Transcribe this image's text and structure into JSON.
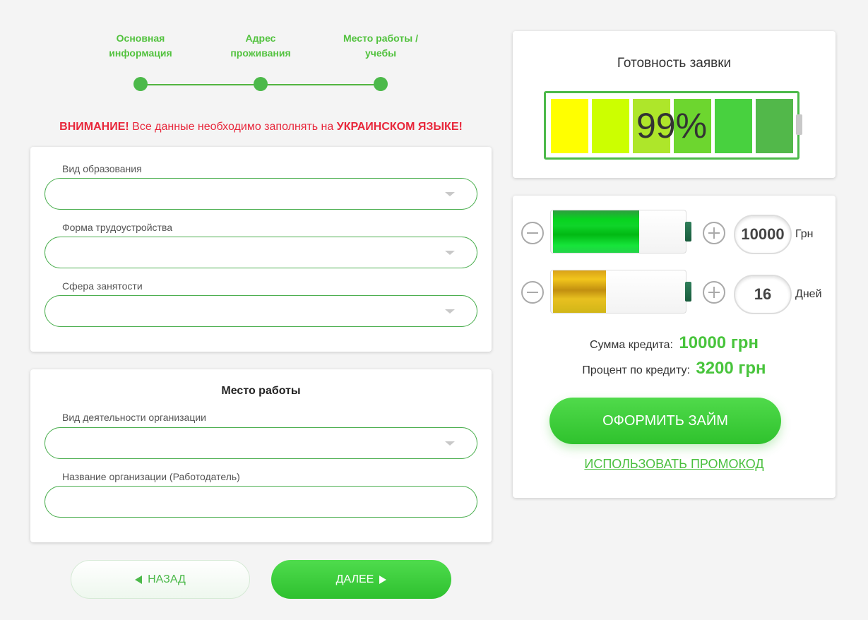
{
  "stepper": {
    "steps": [
      {
        "label": "Основная информация"
      },
      {
        "label": "Адрес проживания"
      },
      {
        "label": "Место работы / учебы"
      }
    ]
  },
  "warning": {
    "prefix": "ВНИМАНИЕ!",
    "text": " Все данные необходимо заполнять на ",
    "emphasis": "УКРАИНСКОМ ЯЗЫКЕ!"
  },
  "employment_card": {
    "fields": [
      {
        "label": "Вид образования",
        "value": ""
      },
      {
        "label": "Форма трудоустройства",
        "value": ""
      },
      {
        "label": "Сфера занятости",
        "value": ""
      }
    ]
  },
  "workplace_card": {
    "title": "Место работы",
    "activity_label": "Вид деятельности организации",
    "activity_value": "",
    "employer_label": "Название организации (Работодатель)",
    "employer_value": ""
  },
  "nav": {
    "back_label": "Назад",
    "next_label": "Далее"
  },
  "readiness": {
    "title": "Готовность заявки",
    "percent_label": "99%",
    "percent": 99,
    "cell_colors": [
      "#ffff00",
      "#ccff00",
      "#aee62a",
      "#6dd62f",
      "#48d13f",
      "#52b84a"
    ]
  },
  "calculator": {
    "amount": {
      "value": "10000",
      "unit": "Грн",
      "fill_fraction": 0.65
    },
    "days": {
      "value": "16",
      "unit": "Дней",
      "fill_fraction": 0.4
    },
    "sum_label": "Сумма кредита:",
    "sum_value": "10000 грн",
    "interest_label": "Процент по кредиту:",
    "interest_value": "3200 грн",
    "apply_label": "Оформить займ",
    "promo_label": "Использовать промокод"
  },
  "colors": {
    "accent": "#4cb94a",
    "warning": "#e8273b"
  }
}
